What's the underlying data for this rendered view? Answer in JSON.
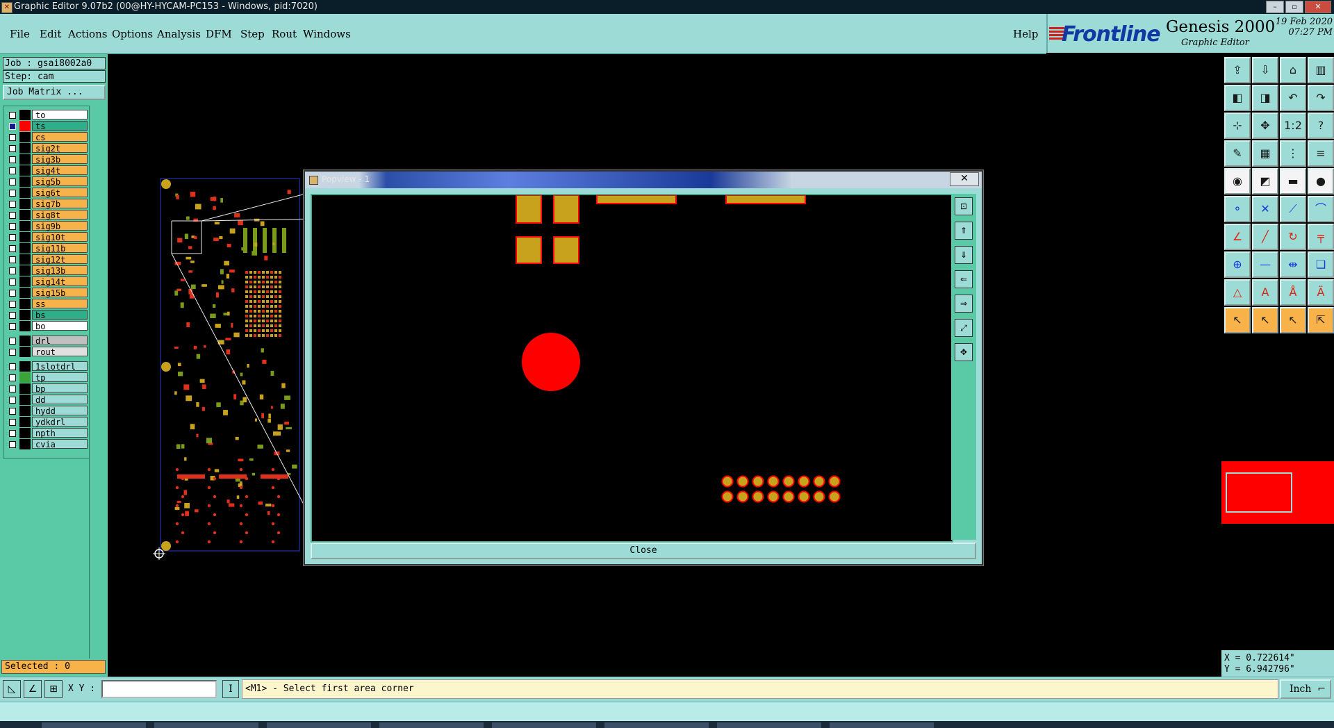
{
  "window": {
    "title": "Graphic Editor 9.07b2 (00@HY-HYCAM-PC153 - Windows, pid:7020)"
  },
  "menu": {
    "items": [
      "File",
      "Edit",
      "Actions",
      "Options",
      "Analysis",
      "DFM",
      "Step",
      "Rout",
      "Windows"
    ],
    "help": "Help"
  },
  "brand": {
    "logo": "Frontline",
    "product": "Genesis 2000",
    "subtitle": "Graphic Editor",
    "date": "19 Feb 2020",
    "time": "07:27 PM"
  },
  "job": {
    "job_label": "Job : gsai8002a0",
    "step_label": "Step: cam",
    "matrix_button": "Job Matrix ..."
  },
  "layers": [
    {
      "name": "to",
      "color": "#ffffff",
      "swatch": "#000000"
    },
    {
      "name": "ts",
      "color": "#2fae8a",
      "swatch": "#ff0000",
      "active": true
    },
    {
      "name": "cs",
      "color": "#f7b24a",
      "swatch": "#000000"
    },
    {
      "name": "sig2t",
      "color": "#f7b24a",
      "swatch": "#000000"
    },
    {
      "name": "sig3b",
      "color": "#f7b24a",
      "swatch": "#000000"
    },
    {
      "name": "sig4t",
      "color": "#f7b24a",
      "swatch": "#000000"
    },
    {
      "name": "sig5b",
      "color": "#f7b24a",
      "swatch": "#000000"
    },
    {
      "name": "sig6t",
      "color": "#f7b24a",
      "swatch": "#000000"
    },
    {
      "name": "sig7b",
      "color": "#f7b24a",
      "swatch": "#000000"
    },
    {
      "name": "sig8t",
      "color": "#f7b24a",
      "swatch": "#000000"
    },
    {
      "name": "sig9b",
      "color": "#f7b24a",
      "swatch": "#000000"
    },
    {
      "name": "sig10t",
      "color": "#f7b24a",
      "swatch": "#000000"
    },
    {
      "name": "sig11b",
      "color": "#f7b24a",
      "swatch": "#000000"
    },
    {
      "name": "sig12t",
      "color": "#f7b24a",
      "swatch": "#000000"
    },
    {
      "name": "sig13b",
      "color": "#f7b24a",
      "swatch": "#000000"
    },
    {
      "name": "sig14t",
      "color": "#f7b24a",
      "swatch": "#000000"
    },
    {
      "name": "sig15b",
      "color": "#f7b24a",
      "swatch": "#000000"
    },
    {
      "name": "ss",
      "color": "#f7b24a",
      "swatch": "#000000"
    },
    {
      "name": "bs",
      "color": "#2fae8a",
      "swatch": "#000000"
    },
    {
      "name": "bo",
      "color": "#ffffff",
      "swatch": "#000000"
    },
    {
      "name": "drl",
      "color": "#c0c0c0",
      "swatch": "#000000",
      "gap_before": true
    },
    {
      "name": "rout",
      "color": "#e0e0e0",
      "swatch": "#000000"
    },
    {
      "name": "1slotdrl",
      "color": "#9ddcd6",
      "swatch": "#000000",
      "gap_before": true
    },
    {
      "name": "tp",
      "color": "#9ddcd6",
      "swatch": "#3aa33a"
    },
    {
      "name": "bp",
      "color": "#9ddcd6",
      "swatch": "#000000"
    },
    {
      "name": "dd",
      "color": "#9ddcd6",
      "swatch": "#000000"
    },
    {
      "name": "hydd",
      "color": "#9ddcd6",
      "swatch": "#000000"
    },
    {
      "name": "ydkdrl",
      "color": "#9ddcd6",
      "swatch": "#000000"
    },
    {
      "name": "npth",
      "color": "#9ddcd6",
      "swatch": "#000000"
    },
    {
      "name": "cvia",
      "color": "#9ddcd6",
      "swatch": "#000000"
    }
  ],
  "selected": "Selected : 0",
  "popview": {
    "title": "Popview - 1",
    "close_x": "✕",
    "close_button": "Close"
  },
  "bottom": {
    "xy_label": "X Y :",
    "xy_value": "",
    "i_button": "I",
    "prompt": "<M1> - Select first area corner",
    "units": "Inch"
  },
  "coords": {
    "x": "X = 0.722614\"",
    "y": "Y = 6.942796\""
  },
  "colors": {
    "panel": "#9ddcd6",
    "panel_dark": "#5ac9a6",
    "pad_gold": "#c8a21c",
    "pad_red": "#ff0000",
    "canvas": "#000000"
  },
  "right_tools": [
    [
      "window-open-icon",
      "window-save-icon",
      "home-icon",
      "layout-icon"
    ],
    [
      "pan-left-icon",
      "pan-right-icon",
      "undo-zoom-icon",
      "redo-zoom-icon"
    ],
    [
      "zoom-fit-icon",
      "zoom-area-icon",
      "scale-icon",
      "help-icon"
    ],
    [
      "snap-icon",
      "grid-icon",
      "filter-icon",
      "layers-icon"
    ],
    [
      "record-icon",
      "draw-icon",
      "measure-icon",
      "pad-icon"
    ],
    [
      "connect-icon",
      "cross-icon",
      "line-icon",
      "arc-icon"
    ],
    [
      "edit-line-icon",
      "slash-icon",
      "rotate-icon",
      "break-icon"
    ],
    [
      "pad-add-icon",
      "minus-icon",
      "move-icon",
      "copy-icon"
    ],
    [
      "triangle-icon",
      "text-a-icon",
      "text-a2-icon",
      "text-a3-icon"
    ],
    [
      "pointer-icon",
      "select-icon",
      "select-plus-icon",
      "select-area-icon"
    ]
  ]
}
